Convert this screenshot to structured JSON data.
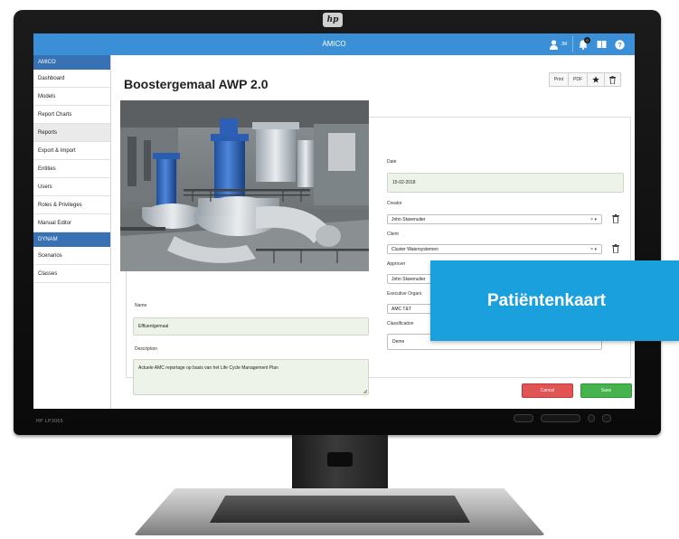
{
  "app": {
    "title": "AMICO",
    "user_initials": "JM",
    "notification_count": "0",
    "monitor_model": "HP LP3065"
  },
  "sidebar": {
    "section_amico": "AMICO",
    "items_amico": [
      "Dashboard",
      "Models",
      "Report Charts",
      "Reports",
      "Export & Import",
      "Entities",
      "Users",
      "Roles & Privileges",
      "Manual Editor"
    ],
    "section_dynam": "DYNAM",
    "items_dynam": [
      "Scenarios",
      "Classes"
    ]
  },
  "page": {
    "title": "Boostergemaal AWP 2.0",
    "actions": {
      "print": "Print",
      "pdf": "PDF"
    }
  },
  "form": {
    "name_label": "Name",
    "name_value": "Effluentgemaal",
    "description_label": "Description",
    "description_value": "Actuele AMC reportage op basis van het Life Cycle Management Plan",
    "date_label": "Date",
    "date_value": "15-02-2018",
    "creator_label": "Creator",
    "creator_value": "John Stavenuiter",
    "client_label": "Client",
    "client_value": "Cluster Watersystemen",
    "approver_label": "Approver",
    "approver_value": "John Stavenuiter",
    "exec_org_label": "Executive Organi",
    "exec_org_value": "AMC T&T",
    "classification_label": "Classification",
    "classification_value": "Demo",
    "caret": "× ▾"
  },
  "buttons": {
    "cancel": "Cancel",
    "save": "Save"
  },
  "banner": {
    "text": "Patiëntenkaart"
  },
  "colors": {
    "topbar": "#3a8fd6",
    "section": "#3872b4",
    "banner": "#1ba0de",
    "cancel": "#e05454",
    "save": "#46b34e"
  }
}
